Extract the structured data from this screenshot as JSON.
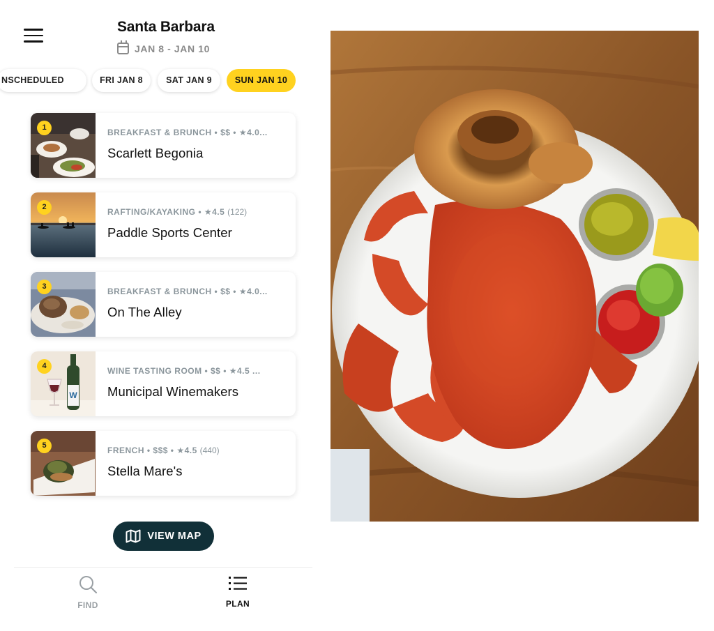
{
  "header": {
    "title": "Santa Barbara",
    "date_range": "JAN 8 - JAN 10"
  },
  "day_tabs": [
    {
      "label": "NSCHEDULED",
      "active": false
    },
    {
      "label": "FRI JAN 8",
      "active": false
    },
    {
      "label": "SAT JAN 9",
      "active": false
    },
    {
      "label": "SUN JAN 10",
      "active": true
    }
  ],
  "places": [
    {
      "number": "1",
      "category": "BREAKFAST & BRUNCH",
      "price": "$$",
      "rating": "★4.0...",
      "reviews": "",
      "name": "Scarlett Begonia"
    },
    {
      "number": "2",
      "category": "RAFTING/KAYAKING",
      "price": "",
      "rating": "★4.5",
      "reviews": "(122)",
      "name": "Paddle Sports Center"
    },
    {
      "number": "3",
      "category": "BREAKFAST & BRUNCH",
      "price": "$$",
      "rating": "★4.0...",
      "reviews": "",
      "name": "On The Alley"
    },
    {
      "number": "4",
      "category": "WINE TASTING ROOM",
      "price": "$$",
      "rating": "★4.5 ...",
      "reviews": "",
      "name": "Municipal Winemakers"
    },
    {
      "number": "5",
      "category": "FRENCH",
      "price": "$$$",
      "rating": "★4.5",
      "reviews": "(440)",
      "name": "Stella Mare's"
    }
  ],
  "view_map": {
    "label": "VIEW MAP",
    "icon": "map-icon"
  },
  "bottom_nav": [
    {
      "label": "FIND",
      "icon": "search-icon",
      "active": false
    },
    {
      "label": "PLAN",
      "icon": "list-icon",
      "active": true
    }
  ],
  "colors": {
    "accent_yellow": "#ffd21f",
    "button_dark": "#113038",
    "meta_gray": "#8b969c"
  }
}
